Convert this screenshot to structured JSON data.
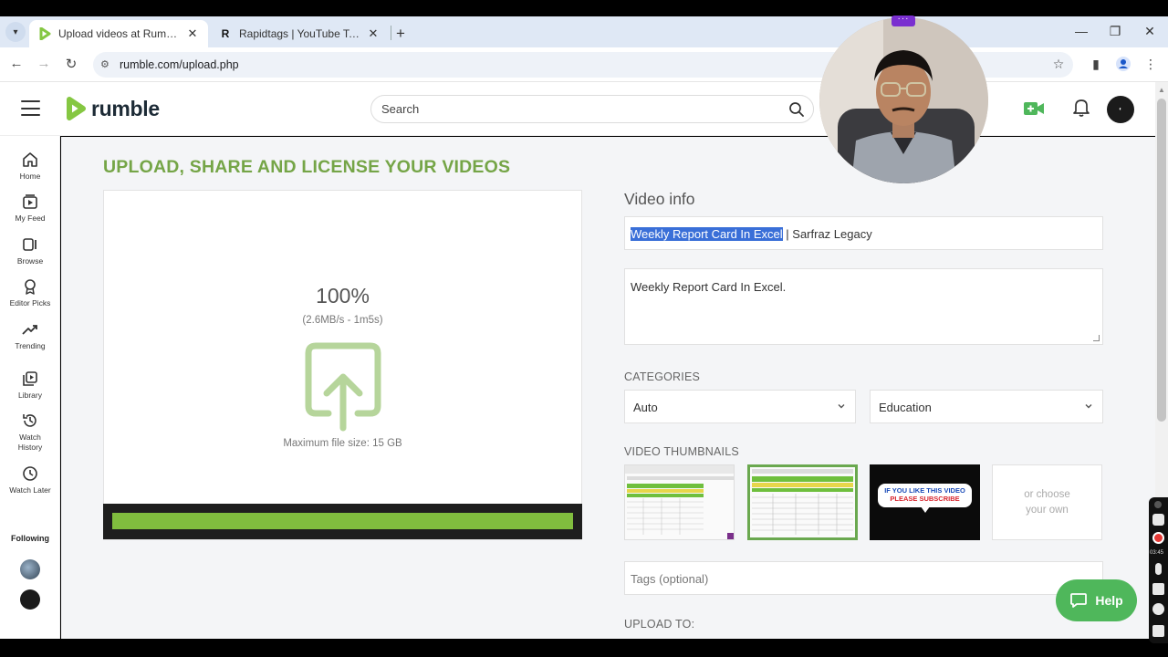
{
  "browser": {
    "tabs": [
      {
        "label": "Upload videos at Rumble",
        "active": true
      },
      {
        "label": "Rapidtags | YouTube Tag Generator",
        "active": false
      }
    ],
    "url": "rumble.com/upload.php"
  },
  "header": {
    "logo_text": "rumble",
    "search_placeholder": "Search"
  },
  "sidebar": {
    "items": [
      {
        "label": "Home",
        "icon": "home-icon"
      },
      {
        "label": "My Feed",
        "icon": "feed-icon"
      },
      {
        "label": "Browse",
        "icon": "browse-icon"
      },
      {
        "label": "Editor Picks",
        "icon": "award-icon"
      },
      {
        "label": "Trending",
        "icon": "trending-icon"
      },
      {
        "label": "Library",
        "icon": "library-icon"
      },
      {
        "label": "Watch History",
        "icon": "history-icon"
      },
      {
        "label": "Watch Later",
        "icon": "clock-icon"
      }
    ],
    "following_label": "Following"
  },
  "upload": {
    "page_title": "UPLOAD, SHARE AND LICENSE YOUR VIDEOS",
    "percent": "100%",
    "progress": 1.0,
    "speed": "(2.6MB/s - 1m5s)",
    "max_size": "Maximum file size: 15 GB"
  },
  "video_info": {
    "heading": "Video info",
    "title_selected": "Weekly Report Card In Excel",
    "title_rest": " | Sarfraz Legacy",
    "description": "Weekly Report Card In Excel.",
    "categories_label": "CATEGORIES",
    "category_1": "Auto",
    "category_2": "Education",
    "thumbnails_label": "VIDEO THUMBNAILS",
    "thumb_subscribe_line1": "IF YOU LIKE THIS VIDEO",
    "thumb_subscribe_line2": "PLEASE SUBSCRIBE",
    "choose_own_line1": "or choose",
    "choose_own_line2": "your own",
    "tags_placeholder": "Tags (optional)",
    "upload_to_label": "UPLOAD TO:"
  },
  "help_label": "Help",
  "recorder_time": "03:45",
  "colors": {
    "brand_green": "#75a547",
    "progress_green": "#80bd3e",
    "help_green": "#4fb75b",
    "selection_blue": "#3a6fd8"
  }
}
